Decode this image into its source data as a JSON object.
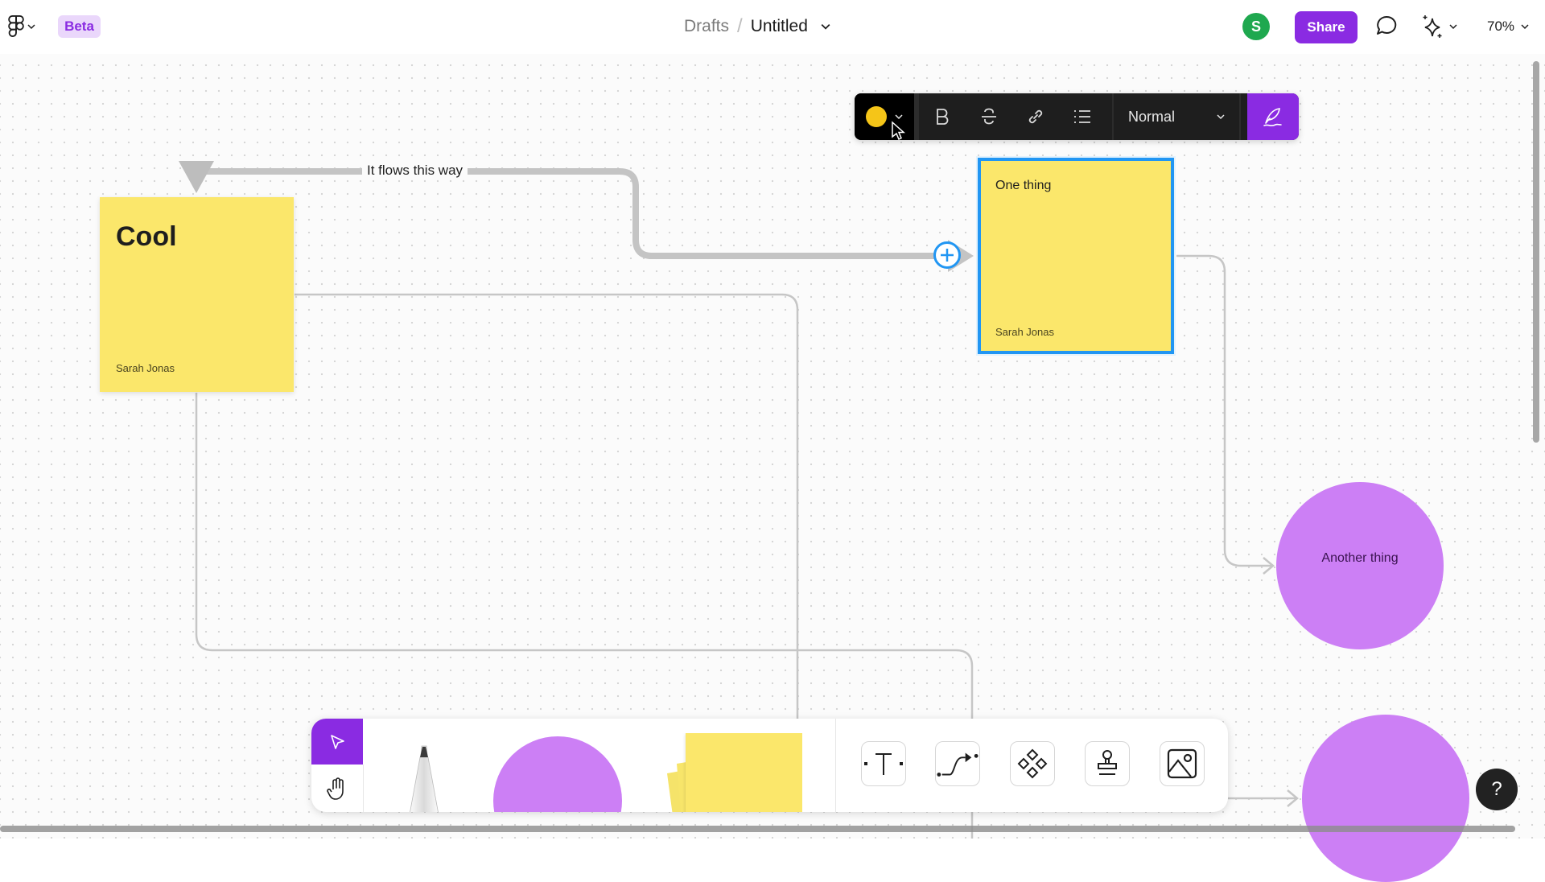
{
  "app": {
    "logo_icon": "figma-logo-icon",
    "badge": "Beta"
  },
  "header": {
    "breadcrumb_parent": "Drafts",
    "breadcrumb_separator": "/",
    "file_title": "Untitled",
    "avatar_initial": "S",
    "share_label": "Share",
    "zoom_level": "70%"
  },
  "format_toolbar": {
    "color": "#f5c518",
    "buttons": [
      "bold",
      "strikethrough",
      "link",
      "list"
    ],
    "text_style": "Normal"
  },
  "canvas": {
    "connector_label": "It flows this way",
    "stickies": [
      {
        "title": "Cool",
        "author": "Sarah Jonas",
        "color": "#fbe76b"
      },
      {
        "title": "One thing",
        "author": "Sarah Jonas",
        "color": "#fbe76b",
        "selected": true
      }
    ],
    "shapes": [
      {
        "type": "circle",
        "label": "Another thing",
        "color": "#cc7ff5"
      },
      {
        "type": "circle",
        "label": "",
        "color": "#cc7ff5"
      }
    ]
  },
  "bottom_toolbar": {
    "tools": [
      "select",
      "hand",
      "marker",
      "shape",
      "sticky",
      "text",
      "connector",
      "components",
      "stamp",
      "image"
    ],
    "active_tool": "select"
  },
  "help_label": "?",
  "colors": {
    "accent": "#8a2be2",
    "selection": "#2196f3",
    "sticky": "#fbe76b",
    "circle": "#cc7ff5",
    "avatar": "#1fa84f"
  }
}
